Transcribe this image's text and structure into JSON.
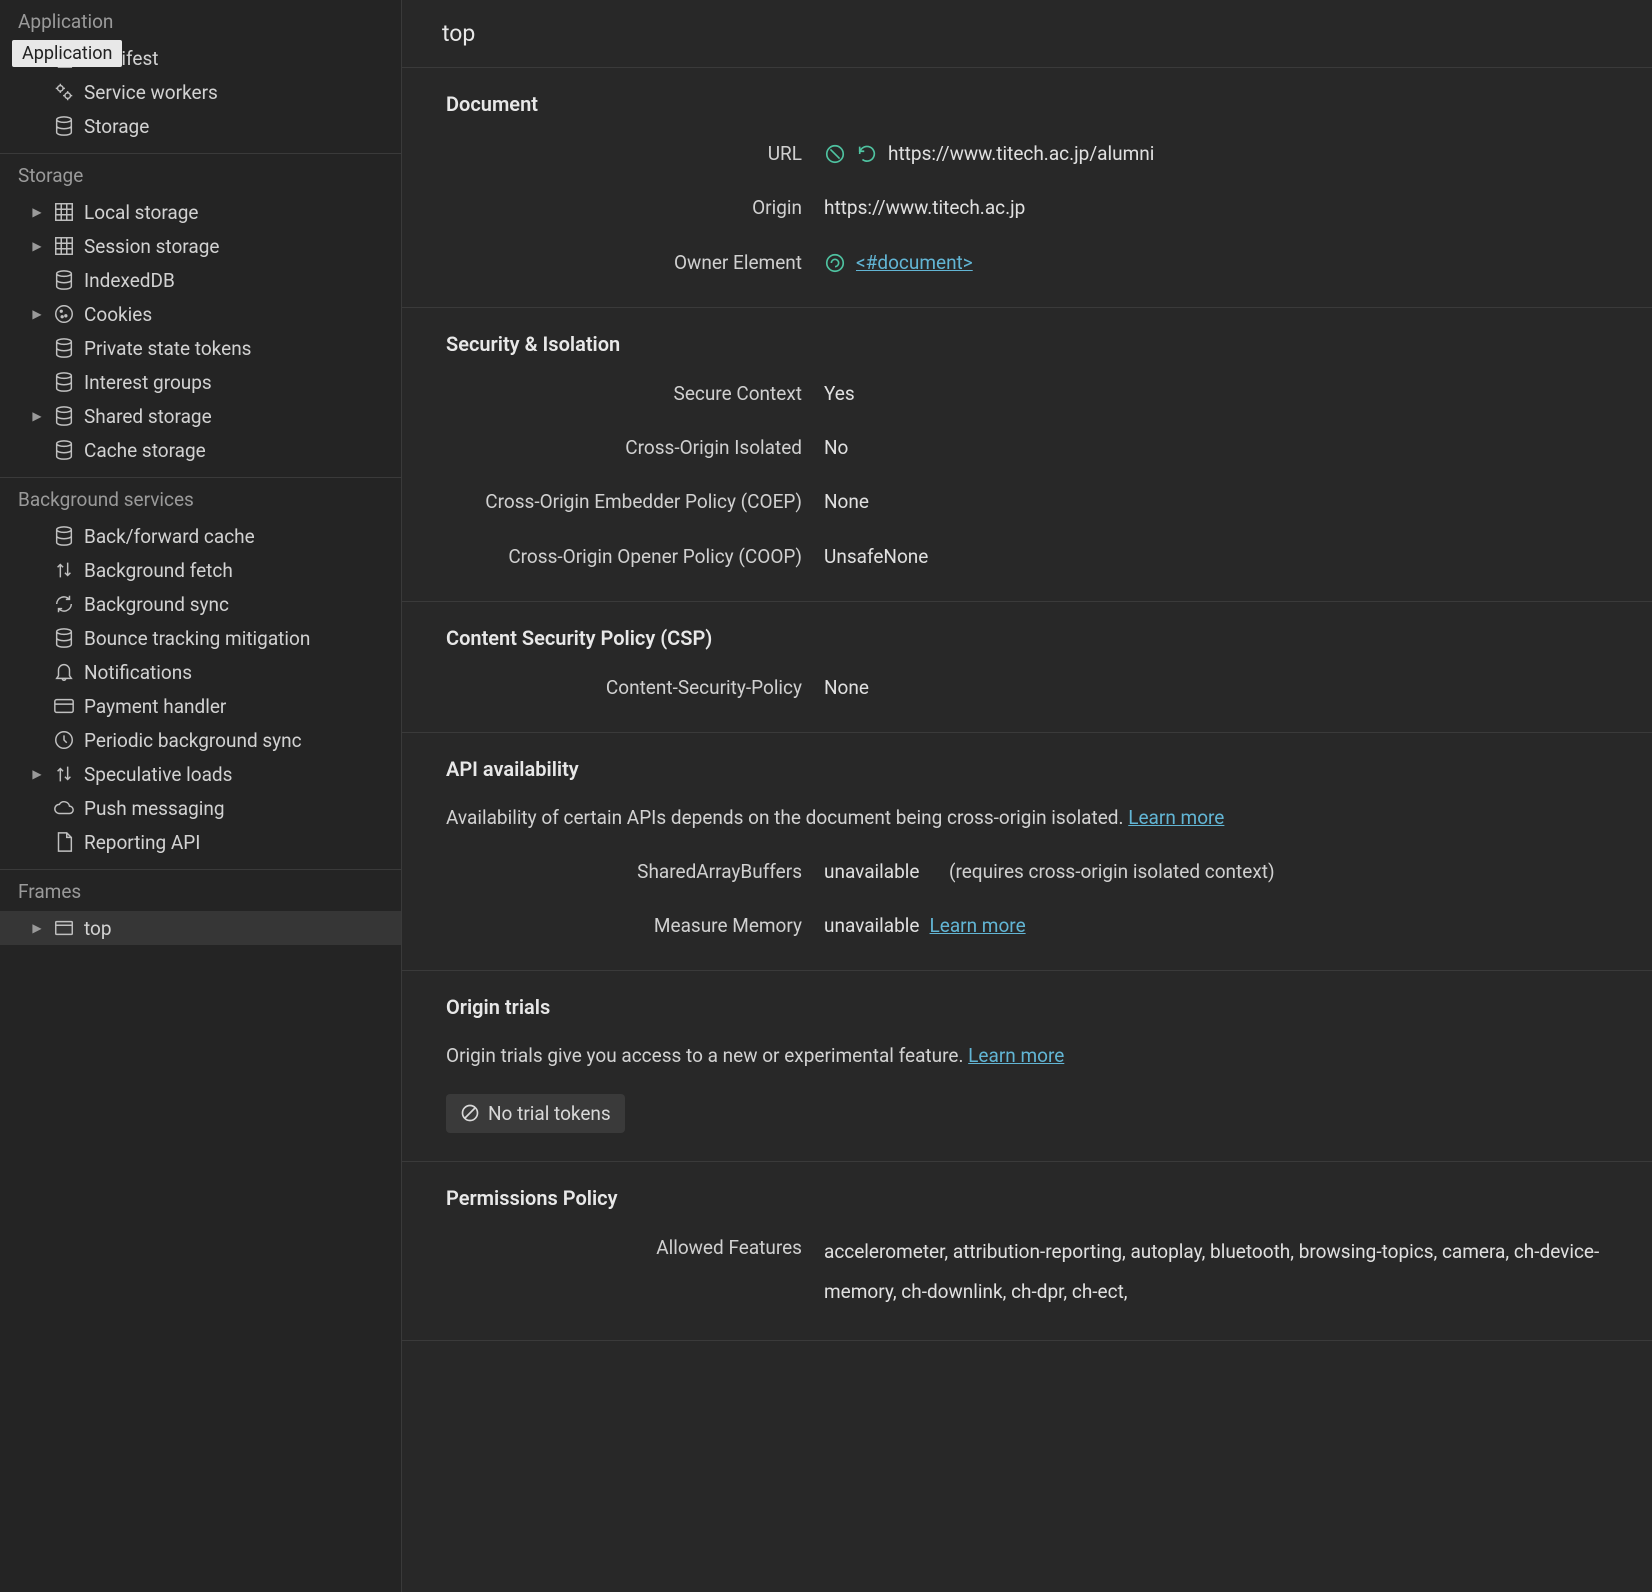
{
  "sidebar": {
    "tooltip": "Application",
    "sections": [
      {
        "title": "Application",
        "items": [
          {
            "label": "Manifest",
            "icon": "doc",
            "chev": false
          },
          {
            "label": "Service workers",
            "icon": "gears",
            "chev": false
          },
          {
            "label": "Storage",
            "icon": "db",
            "chev": false
          }
        ]
      },
      {
        "title": "Storage",
        "items": [
          {
            "label": "Local storage",
            "icon": "grid",
            "chev": true
          },
          {
            "label": "Session storage",
            "icon": "grid",
            "chev": true
          },
          {
            "label": "IndexedDB",
            "icon": "db",
            "chev": false
          },
          {
            "label": "Cookies",
            "icon": "cookie",
            "chev": true
          },
          {
            "label": "Private state tokens",
            "icon": "db",
            "chev": false
          },
          {
            "label": "Interest groups",
            "icon": "db",
            "chev": false
          },
          {
            "label": "Shared storage",
            "icon": "db",
            "chev": true
          },
          {
            "label": "Cache storage",
            "icon": "db",
            "chev": false
          }
        ]
      },
      {
        "title": "Background services",
        "items": [
          {
            "label": "Back/forward cache",
            "icon": "db",
            "chev": false
          },
          {
            "label": "Background fetch",
            "icon": "updown",
            "chev": false
          },
          {
            "label": "Background sync",
            "icon": "sync",
            "chev": false
          },
          {
            "label": "Bounce tracking mitigation",
            "icon": "db",
            "chev": false
          },
          {
            "label": "Notifications",
            "icon": "bell",
            "chev": false
          },
          {
            "label": "Payment handler",
            "icon": "card",
            "chev": false
          },
          {
            "label": "Periodic background sync",
            "icon": "clock",
            "chev": false
          },
          {
            "label": "Speculative loads",
            "icon": "updown",
            "chev": true
          },
          {
            "label": "Push messaging",
            "icon": "cloud",
            "chev": false
          },
          {
            "label": "Reporting API",
            "icon": "doc",
            "chev": false
          }
        ]
      },
      {
        "title": "Frames",
        "items": [
          {
            "label": "top",
            "icon": "frame",
            "chev": true,
            "selected": true
          }
        ]
      }
    ]
  },
  "header": {
    "title": "top"
  },
  "document": {
    "heading": "Document",
    "url_label": "URL",
    "url": "https://www.titech.ac.jp/alumni",
    "origin_label": "Origin",
    "origin": "https://www.titech.ac.jp",
    "owner_label": "Owner Element",
    "owner": "<#document>"
  },
  "security": {
    "heading": "Security & Isolation",
    "secure_label": "Secure Context",
    "secure": "Yes",
    "coi_label": "Cross-Origin Isolated",
    "coi": "No",
    "coep_label": "Cross-Origin Embedder Policy (COEP)",
    "coep": "None",
    "coop_label": "Cross-Origin Opener Policy (COOP)",
    "coop": "UnsafeNone"
  },
  "csp": {
    "heading": "Content Security Policy (CSP)",
    "label": "Content-Security-Policy",
    "value": "None"
  },
  "api": {
    "heading": "API availability",
    "desc": "Availability of certain APIs depends on the document being cross-origin isolated. ",
    "learn": "Learn more",
    "sab_label": "SharedArrayBuffers",
    "sab": "unavailable",
    "sab_hint": "(requires cross-origin isolated context)",
    "mm_label": "Measure Memory",
    "mm": "unavailable",
    "mm_learn": "Learn more"
  },
  "origintrials": {
    "heading": "Origin trials",
    "desc": "Origin trials give you access to a new or experimental feature. ",
    "learn": "Learn more",
    "none": "No trial tokens"
  },
  "permissions": {
    "heading": "Permissions Policy",
    "allowed_label": "Allowed Features",
    "allowed": "accelerometer, attribution-reporting, autoplay, bluetooth, browsing-topics, camera, ch-device-memory, ch-downlink, ch-dpr, ch-ect,"
  }
}
